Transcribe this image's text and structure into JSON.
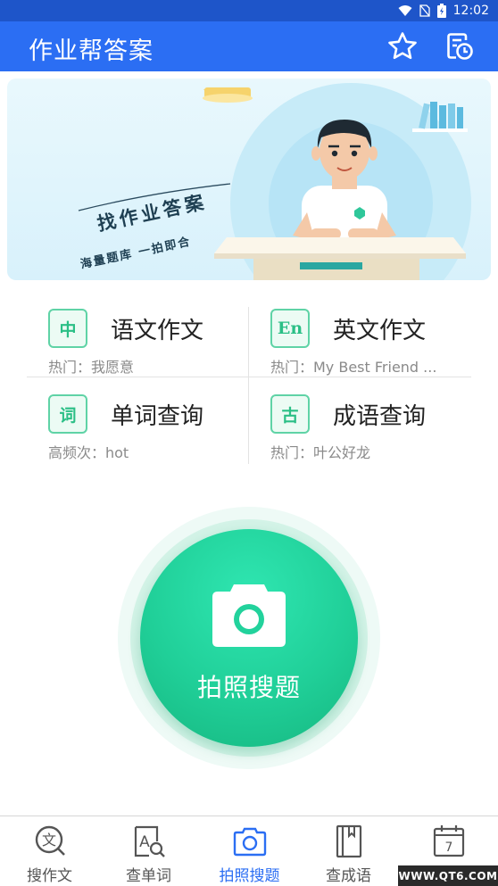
{
  "status_bar": {
    "time": "12:02",
    "icons": [
      "wifi-icon",
      "sim-off-icon",
      "battery-icon"
    ]
  },
  "app_bar": {
    "title": "作业帮答案",
    "actions": [
      "star-icon",
      "history-icon"
    ]
  },
  "banner": {
    "headline": "找作业答案",
    "subline": "海量题库 一拍即合"
  },
  "features": [
    {
      "icon_char": "中",
      "title": "语文作文",
      "subtitle": "热门：我愿意"
    },
    {
      "icon_char": "En",
      "title": "英文作文",
      "subtitle": "热门：My Best Friend ..."
    },
    {
      "icon_char": "词",
      "title": "单词查询",
      "subtitle": "高频次：hot"
    },
    {
      "icon_char": "古",
      "title": "成语查询",
      "subtitle": "热门：叶公好龙"
    }
  ],
  "camera": {
    "label": "拍照搜题"
  },
  "bottom_nav": {
    "items": [
      {
        "label": "搜作文",
        "icon": "search-essay-icon"
      },
      {
        "label": "查单词",
        "icon": "search-word-icon"
      },
      {
        "label": "拍照搜题",
        "icon": "camera-icon",
        "active": true
      },
      {
        "label": "查成语",
        "icon": "book-icon"
      },
      {
        "label": "",
        "icon": "calendar-icon",
        "calendar_day": "7"
      }
    ]
  },
  "watermark": "WWW.QT6.COM",
  "colors": {
    "primary": "#2b6ef3",
    "status_bar": "#1e55c9",
    "accent_green": "#20cf98",
    "icon_green": "#2bbf86"
  }
}
